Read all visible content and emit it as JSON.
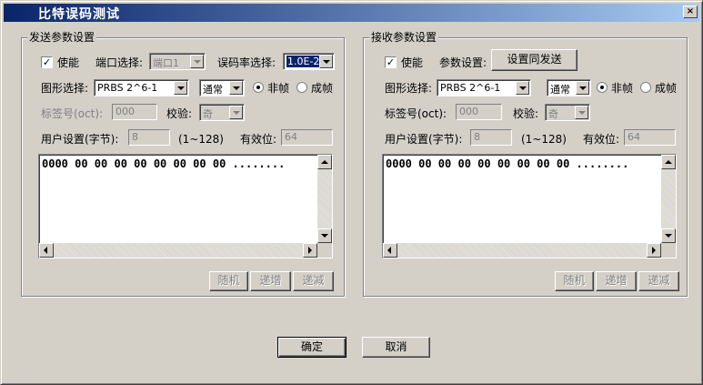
{
  "window": {
    "title": "比特误码测试",
    "close_glyph": "×"
  },
  "send": {
    "group_title": "发送参数设置",
    "enable_label": "使能",
    "enable_checked": true,
    "port_label": "端口选择:",
    "port_value": "端口1",
    "ber_label": "误码率选择:",
    "ber_value": "1.0E-2",
    "pattern_label": "图形选择:",
    "pattern_value": "PRBS 2^6-1",
    "mode_value": "通常",
    "unframed_label": "非帧",
    "framed_label": "成帧",
    "selected_frame": "unframed",
    "tag_label": "标签号(oct):",
    "tag_value": "000",
    "check_label": "校验:",
    "check_value": "奇",
    "user_label": "用户设置(字节):",
    "user_value": "8",
    "range_label": "(1~128)",
    "valid_label": "有效位:",
    "valid_value": "64",
    "memo_text": "0000 00 00 00 00 00 00 00 00 ........",
    "btn_random": "随机",
    "btn_inc": "递增",
    "btn_dec": "递减"
  },
  "recv": {
    "group_title": "接收参数设置",
    "enable_label": "使能",
    "enable_checked": true,
    "param_label": "参数设置:",
    "same_as_send_button": "设置同发送",
    "pattern_label": "图形选择:",
    "pattern_value": "PRBS 2^6-1",
    "mode_value": "通常",
    "unframed_label": "非帧",
    "framed_label": "成帧",
    "selected_frame": "unframed",
    "tag_label": "标签号(oct):",
    "tag_value": "000",
    "check_label": "校验:",
    "check_value": "奇",
    "user_label": "用户设置(字节):",
    "user_value": "8",
    "range_label": "(1~128)",
    "valid_label": "有效位:",
    "valid_value": "64",
    "memo_text": "0000 00 00 00 00 00 00 00 00 ........",
    "btn_random": "随机",
    "btn_inc": "递增",
    "btn_dec": "递减"
  },
  "footer": {
    "ok_label": "确定",
    "cancel_label": "取消"
  }
}
